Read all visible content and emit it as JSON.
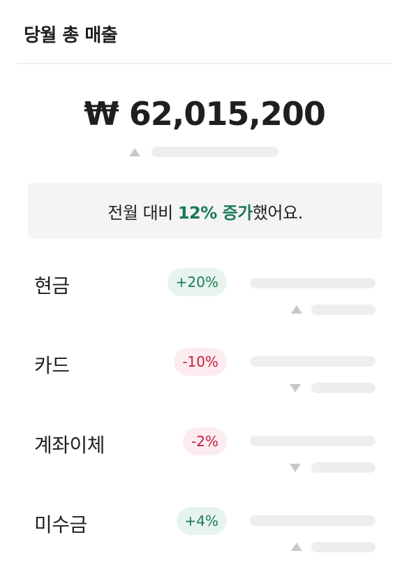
{
  "header": {
    "title": "당월 총 매출"
  },
  "total": {
    "amount": "₩ 62,015,200",
    "trend": "up"
  },
  "comparison": {
    "prefix": "전월 대비 ",
    "highlight": "12% 증가",
    "suffix": "했어요."
  },
  "items": [
    {
      "label": "현금",
      "change": "+20%",
      "trend": "up"
    },
    {
      "label": "카드",
      "change": "-10%",
      "trend": "down"
    },
    {
      "label": "계좌이체",
      "change": "-2%",
      "trend": "down"
    },
    {
      "label": "미수금",
      "change": "+4%",
      "trend": "up"
    }
  ],
  "colors": {
    "positive": "#1a7a55",
    "positive_bg": "#e7f4ee",
    "negative": "#c41f3b",
    "negative_bg": "#fdecef",
    "skeleton": "#eeeeee"
  },
  "icons": {
    "trend_up": "triangle-up-icon",
    "trend_down": "triangle-down-icon"
  }
}
